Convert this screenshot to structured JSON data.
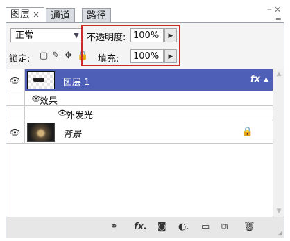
{
  "tabs": [
    {
      "label": "图层",
      "close": "×"
    },
    {
      "label": "通道"
    },
    {
      "label": "路径"
    }
  ],
  "window": {
    "minimize": "–",
    "close": "×",
    "menu": "≡"
  },
  "controls": {
    "blend_mode": "正常",
    "opacity_label": "不透明度:",
    "opacity_value": "100%",
    "lock_label": "锁定:",
    "fill_label": "填充:",
    "fill_value": "100%",
    "arrow": "▶",
    "dropdown_arrow": "▼"
  },
  "lock_icons": [
    "lock-transparent-icon",
    "brush-icon",
    "move-icon",
    "lock-icon"
  ],
  "lock_glyphs": {
    "transparent": "▢",
    "brush": "✎",
    "move": "✥",
    "lock": "🔒"
  },
  "layers": {
    "layer1": {
      "name": "图层 1",
      "fx": "fx",
      "toggle": "▲"
    },
    "effects": {
      "name": "效果"
    },
    "outer_glow": {
      "name": "外发光"
    },
    "background": {
      "name": "背景",
      "lock": "🔒"
    }
  },
  "eye_glyph": "👁",
  "toolbar_glyphs": {
    "link": "⚭",
    "fx": "fx.",
    "mask": "◙",
    "adjust": "◐.",
    "group": "▭",
    "new": "⧉",
    "trash": "🗑"
  }
}
